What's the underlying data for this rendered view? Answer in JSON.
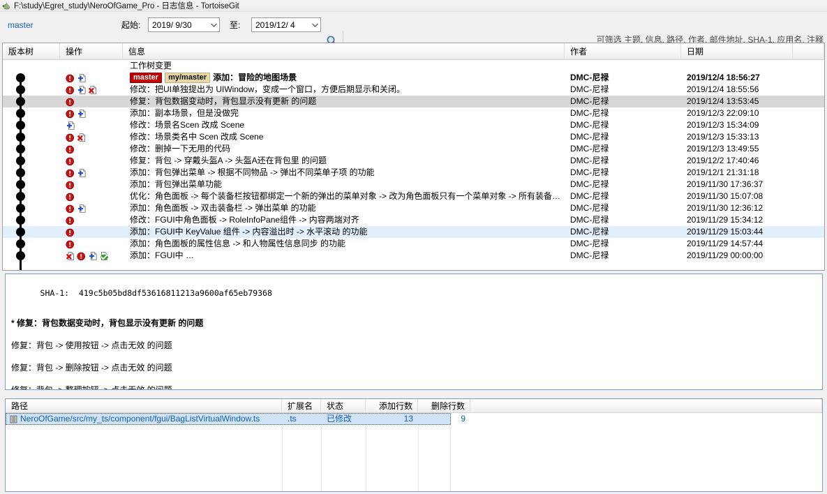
{
  "window": {
    "title": "F:\\study\\Egret_study\\NeroOfGame_Pro - 日志信息 - TortoiseGit",
    "app_icon": "tortoise-icon"
  },
  "toolbar": {
    "branch": "master",
    "from_label": "起始:",
    "from_value": "2019/ 9/30",
    "to_label": "至:",
    "to_value": "2019/12/ 4",
    "search_icon": "magnifier-icon",
    "search_placeholder": "可筛选 主题, 信息, 路径, 作者, 邮件地址, SHA-1, 应用名, 注释"
  },
  "commit_list": {
    "columns": [
      "版本树",
      "操作",
      "信息",
      "作者",
      "日期"
    ],
    "rows": [
      {
        "icons": [],
        "refs": [],
        "message": "工作树变更",
        "author": "",
        "date": "",
        "bold": false,
        "select": ""
      },
      {
        "icons": [
          "modified-icon",
          "added-icon"
        ],
        "refs": [
          {
            "name": "master",
            "type": "head"
          },
          {
            "name": "my/master",
            "type": "remote"
          }
        ],
        "message": "添加：冒险的地图场景",
        "author": "DMC-尼禄",
        "date": "2019/12/4 18:56:27",
        "bold": true,
        "select": ""
      },
      {
        "icons": [
          "modified-icon",
          "added-icon",
          "deleted-icon"
        ],
        "refs": [],
        "message": "修改：把UI单独提出为 UIWindow，变成一个窗口，方便后期显示和关闭。",
        "author": "DMC-尼禄",
        "date": "2019/12/4 18:55:56",
        "bold": false,
        "select": ""
      },
      {
        "icons": [
          "modified-icon"
        ],
        "refs": [],
        "message": "修复：背包数据变动时，背包显示没有更新 的问题",
        "author": "DMC-尼禄",
        "date": "2019/12/4 13:53:45",
        "bold": false,
        "select": "gray"
      },
      {
        "icons": [
          "modified-icon",
          "added-icon"
        ],
        "refs": [],
        "message": "添加：副本场景，但是没做完",
        "author": "DMC-尼禄",
        "date": "2019/12/3 22:09:10",
        "bold": false,
        "select": ""
      },
      {
        "icons": [
          "added-icon"
        ],
        "refs": [],
        "message": "修改：场景名Scen 改成 Scene",
        "author": "DMC-尼禄",
        "date": "2019/12/3 15:34:09",
        "bold": false,
        "select": ""
      },
      {
        "icons": [
          "modified-icon",
          "deleted-icon"
        ],
        "refs": [],
        "message": "修改：场景类名中 Scen 改成 Scene",
        "author": "DMC-尼禄",
        "date": "2019/12/3 15:33:13",
        "bold": false,
        "select": ""
      },
      {
        "icons": [
          "modified-icon"
        ],
        "refs": [],
        "message": "修改：删掉一下无用的代码",
        "author": "DMC-尼禄",
        "date": "2019/12/3 13:49:55",
        "bold": false,
        "select": ""
      },
      {
        "icons": [
          "modified-icon"
        ],
        "refs": [],
        "message": "修复：背包 -> 穿戴头盔A -> 头盔A还在背包里 的问题",
        "author": "DMC-尼禄",
        "date": "2019/12/2 17:40:46",
        "bold": false,
        "select": ""
      },
      {
        "icons": [
          "modified-icon",
          "added-icon"
        ],
        "refs": [],
        "message": "添加：背包弹出菜单 -> 根据不同物品 -> 弹出不同菜单子项 的功能",
        "author": "DMC-尼禄",
        "date": "2019/12/1 21:31:18",
        "bold": false,
        "select": ""
      },
      {
        "icons": [
          "modified-icon"
        ],
        "refs": [],
        "message": "添加：背包弹出菜单功能",
        "author": "DMC-尼禄",
        "date": "2019/11/30 17:36:37",
        "bold": false,
        "select": ""
      },
      {
        "icons": [
          "modified-icon"
        ],
        "refs": [],
        "message": "优化：角色面板 -> 每个装备栏按钮都绑定一个新的弹出的菜单对象 -> 改为角色面板只有一个菜单对象 -> 所有装备…",
        "author": "DMC-尼禄",
        "date": "2019/11/30 15:07:08",
        "bold": false,
        "select": ""
      },
      {
        "icons": [
          "modified-icon",
          "added-icon"
        ],
        "refs": [],
        "message": "添加：角色面板 -> 双击装备栏 -> 弹出菜单 的功能",
        "author": "DMC-尼禄",
        "date": "2019/11/30 12:36:12",
        "bold": false,
        "select": ""
      },
      {
        "icons": [
          "modified-icon"
        ],
        "refs": [],
        "message": "修改：FGUI中角色面板 -> RoleInfoPane组件 -> 内容两端对齐",
        "author": "DMC-尼禄",
        "date": "2019/11/29 15:34:12",
        "bold": false,
        "select": ""
      },
      {
        "icons": [
          "modified-icon"
        ],
        "refs": [],
        "message": "添加：FGUI中 KeyValue 组件 -> 内容溢出时 -> 水平滚动 的功能",
        "author": "DMC-尼禄",
        "date": "2019/11/29 15:03:44",
        "bold": false,
        "select": "blue"
      },
      {
        "icons": [
          "modified-icon"
        ],
        "refs": [],
        "message": "添加：角色面板的属性信息 -> 和人物属性信息同步 的功能",
        "author": "DMC-尼禄",
        "date": "2019/11/29 14:57:44",
        "bold": false,
        "select": ""
      },
      {
        "icons": [
          "deleted-icon",
          "modified-icon",
          "added-icon",
          "renamed-icon"
        ],
        "refs": [],
        "message": "添加：FGUI中 …",
        "author": "DMC-尼禄",
        "date": "2019/11/29 00:00:00",
        "bold": false,
        "select": ""
      }
    ]
  },
  "detail": {
    "sha_label": "SHA-1:",
    "sha_value": "419c5b05bd8df53616811213a9600af65eb79368",
    "subject": "* 修复：背包数据变动时，背包显示没有更新 的问题",
    "body_lines": [
      "修复：背包 -> 使用按钮 -> 点击无效 的问题",
      "修复：背包 -> 删除按钮 -> 点击无效 的问题",
      "修复：背包 -> 整理按钮 -> 点击无效 的问题"
    ]
  },
  "file_list": {
    "columns": [
      "路径",
      "扩展名",
      "状态",
      "添加行数",
      "删除行数"
    ],
    "rows": [
      {
        "icon": "file-icon",
        "path": "NeroOfGame/src/my_ts/component/fgui/BagListVirtualWindow.ts",
        "ext": ".ts",
        "status": "已修改",
        "added": "13",
        "deleted": "9"
      }
    ]
  },
  "colors": {
    "head_ref_bg": "#c00000",
    "remote_ref_bg": "#e8d8a8",
    "link": "#1565b0",
    "selection_gray": "#d8d8d8",
    "selection_blue": "#e2eefa",
    "file_selection": "#cfe3f7"
  }
}
